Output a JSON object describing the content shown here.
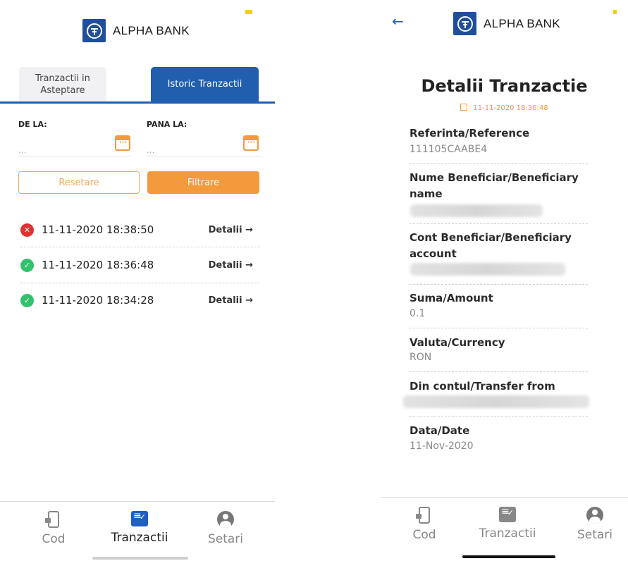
{
  "brand": {
    "name": "ALPHA BANK",
    "color": "#1f4f9c"
  },
  "list_screen": {
    "tabs": [
      {
        "label": "Tranzactii in Asteptare",
        "active": false
      },
      {
        "label": "Istoric Tranzactii",
        "active": true
      }
    ],
    "filter": {
      "from_label": "DE LA:",
      "to_label": "PANA LA:",
      "from_placeholder": "...",
      "to_placeholder": "...",
      "reset_label": "Resetare",
      "filter_label": "Filtrare"
    },
    "transactions": [
      {
        "datetime": "11-11-2020 18:38:50",
        "status": "failed",
        "link": "Detalii →"
      },
      {
        "datetime": "11-11-2020 18:36:48",
        "status": "success",
        "link": "Detalii →"
      },
      {
        "datetime": "11-11-2020 18:34:28",
        "status": "success",
        "link": "Detalii →"
      }
    ]
  },
  "detail_screen": {
    "title": "Detalii Tranzactie",
    "datetime": "11-11-2020 18:36:48",
    "fields": [
      {
        "label": "Referinta/Reference",
        "value": "111105CAABE4"
      },
      {
        "label": "Nume Beneficiar/Beneficiary name",
        "value": null
      },
      {
        "label": "Cont Beneficiar/Beneficiary account",
        "value": null
      },
      {
        "label": "Suma/Amount",
        "value": "0.1"
      },
      {
        "label": "Valuta/Currency",
        "value": "RON"
      },
      {
        "label": "Din contul/Transfer from",
        "value": null
      },
      {
        "label": "Data/Date",
        "value": "11-Nov-2020"
      }
    ]
  },
  "nav": {
    "items": [
      {
        "label": "Cod",
        "icon": "phone-lock-icon"
      },
      {
        "label": "Tranzactii",
        "icon": "transactions-icon"
      },
      {
        "label": "Setari",
        "icon": "user-icon"
      }
    ],
    "active_index_left": 1,
    "active_index_right": null
  },
  "colors": {
    "accent_blue": "#1f5fae",
    "accent_orange": "#f29a3c",
    "status_failed": "#e03131",
    "status_success": "#33c26b"
  }
}
